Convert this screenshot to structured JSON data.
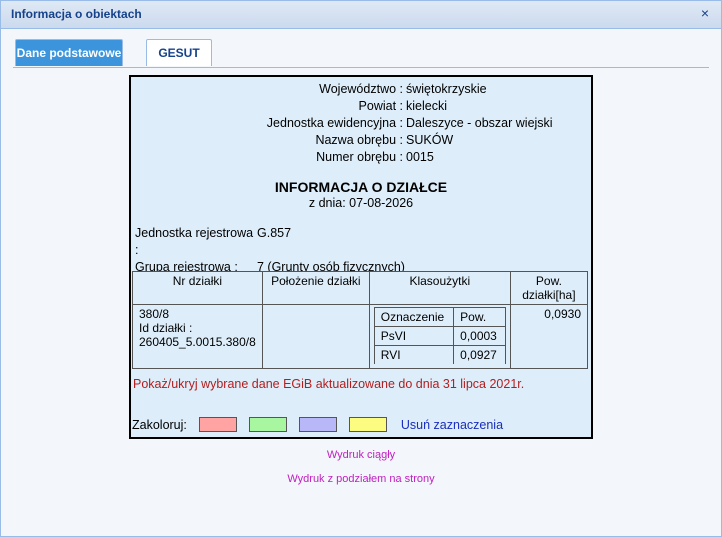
{
  "window": {
    "title": "Informacja o obiektach",
    "close_symbol": "×"
  },
  "tabs": [
    {
      "label": "Dane podstawowe",
      "active": true
    },
    {
      "label": "GESUT",
      "active": false
    }
  ],
  "location": [
    {
      "label": "Województwo :",
      "value": "świętokrzyskie"
    },
    {
      "label": "Powiat :",
      "value": "kielecki"
    },
    {
      "label": "Jednostka ewidencyjna :",
      "value": "Daleszyce - obszar wiejski"
    },
    {
      "label": "Nazwa obrębu :",
      "value": "SUKÓW"
    },
    {
      "label": "Numer obrębu :",
      "value": "0015"
    }
  ],
  "heading": "INFORMACJA O DZIAŁCE",
  "date_line": "z dnia: 07-08-2026",
  "registry": [
    {
      "label": "Jednostka rejestrowa :",
      "value": "G.857"
    },
    {
      "label": "Grupa rejestrowa :",
      "value": "7 (Grunty osób fizycznych)"
    }
  ],
  "table": {
    "headers": [
      "Nr działki",
      "Położenie działki",
      "Klasoużytki",
      "Pow. działki[ha]"
    ],
    "plot_number": "380/8",
    "plot_id_label": "Id działki :",
    "plot_id": "260405_5.0015.380/8",
    "location": "",
    "klas_headers": [
      "Oznaczenie",
      "Pow."
    ],
    "klas_rows": [
      [
        "PsVI",
        "0,0003"
      ],
      [
        "RVI",
        "0,0927"
      ]
    ],
    "area": "0,0930"
  },
  "notice": "Pokaż/ukryj wybrane dane EGiB aktualizowane do dnia 31 lipca 2021r.",
  "colorize": {
    "label": "Zakoloruj:",
    "swatches": [
      "#ffa3a3",
      "#a8f7a0",
      "#b8b8f8",
      "#fcfc80"
    ],
    "clear_label": "Usuń zaznaczenia"
  },
  "links": {
    "continuous": "Wydruk ciągły",
    "paged": "Wydruk z podziałem na strony"
  }
}
